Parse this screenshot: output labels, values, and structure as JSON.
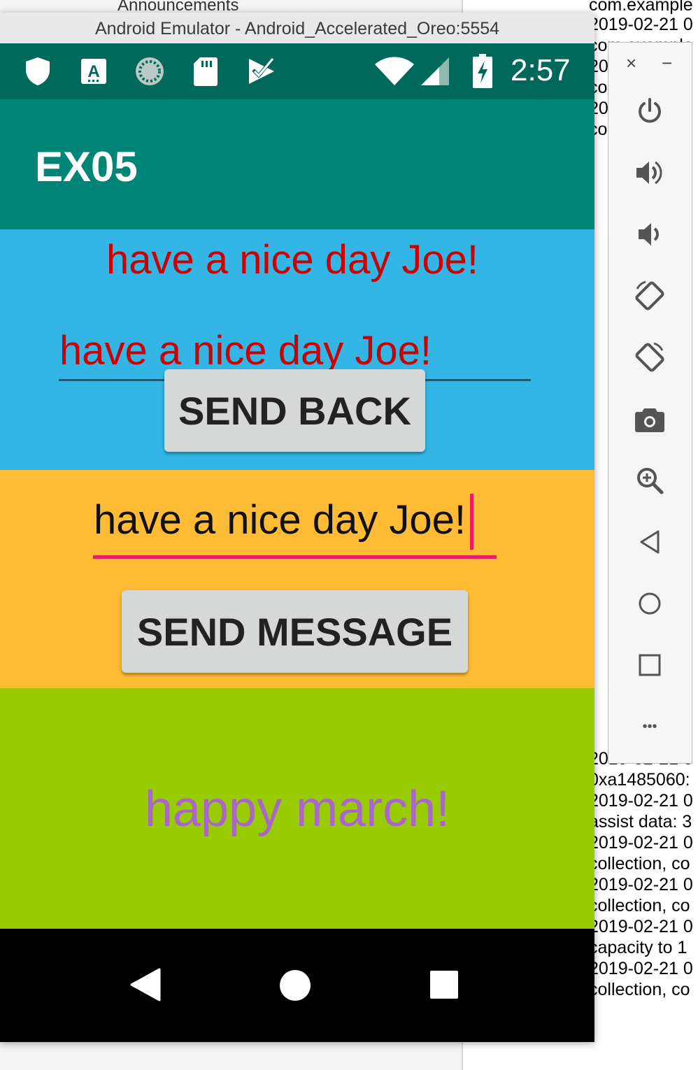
{
  "background": {
    "announcement_text": "Announcements",
    "log_lines": [
      "com.example",
      "2019-02-21 0",
      "com.example",
      "2019-02-21 0",
      "com.example",
      "2019-02-21 0",
      "com.example",
      "2019-02-21 0",
      "0xa1485060:",
      "2019-02-21 0",
      "assist data: 3",
      "2019-02-21 0",
      "collection, co",
      "2019-02-21 0",
      "collection, co",
      "2019-02-21 0",
      "capacity to 1",
      "2019-02-21 0",
      "collection, co"
    ]
  },
  "window": {
    "title": "Android Emulator - Android_Accelerated_Oreo:5554"
  },
  "statusbar": {
    "time": "2:57",
    "left_icons": [
      "shield-icon",
      "keyboard-a-icon",
      "sync-spinner-icon",
      "sd-card-icon",
      "check-badge-icon"
    ],
    "right_icons": [
      "wifi-icon",
      "signal-icon",
      "battery-charging-icon"
    ]
  },
  "app": {
    "title": "EX05",
    "blue_section": {
      "message_text": "have a nice day Joe!",
      "edit_value": "have a nice day Joe!",
      "button_label": "SEND BACK"
    },
    "orange_section": {
      "edit_value": "have a nice day Joe!",
      "button_label": "SEND MESSAGE"
    },
    "green_section": {
      "text": "happy march!"
    }
  },
  "colors": {
    "statusbar": "#00695c",
    "appbar": "#008577",
    "blue": "#33b5e5",
    "orange": "#ffbb33",
    "green": "#99cc00",
    "red_text": "#cc0000",
    "purple_text": "#aa66cc",
    "accent": "#e91e63"
  },
  "navbar": {
    "buttons": [
      "back-icon",
      "home-icon",
      "recents-icon"
    ]
  },
  "emulator_toolbar": {
    "close_symbol": "×",
    "minimize_symbol": "−",
    "more_symbol": "•••",
    "buttons": [
      "power-icon",
      "volume-up-icon",
      "volume-down-icon",
      "rotate-left-icon",
      "rotate-right-icon",
      "camera-icon",
      "zoom-icon",
      "back-icon",
      "home-icon",
      "overview-icon",
      "more-icon"
    ]
  }
}
